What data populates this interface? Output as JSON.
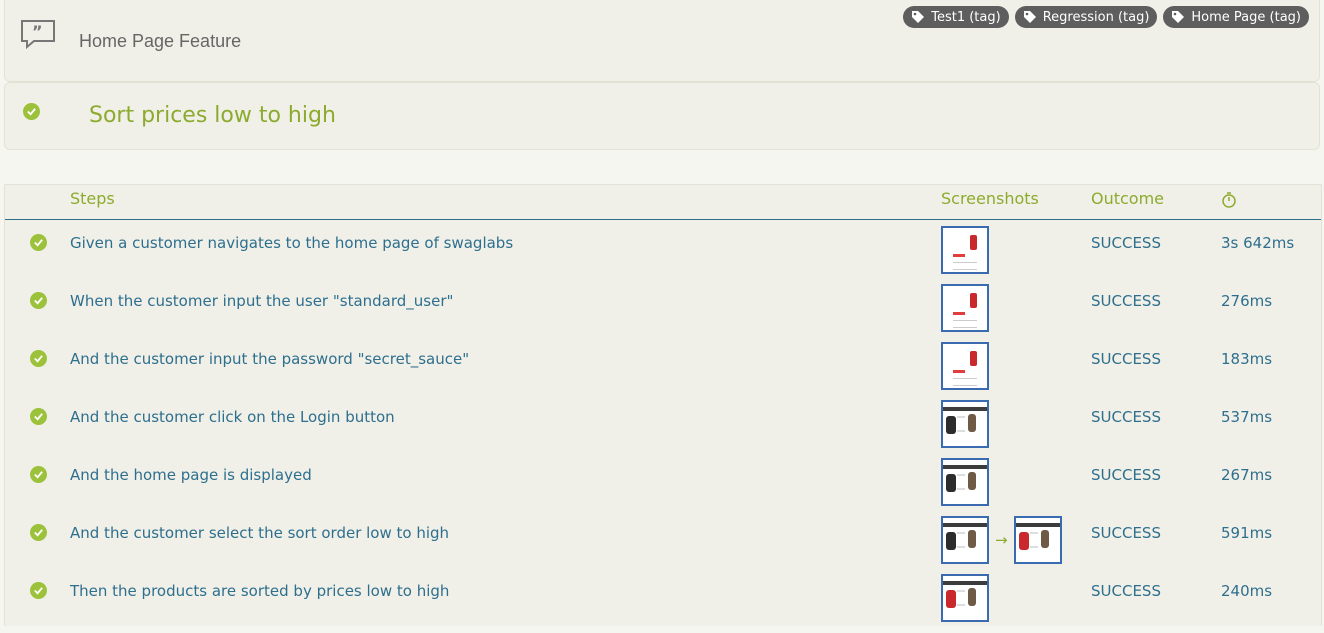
{
  "feature": {
    "title": "Home Page Feature",
    "icon": "quote-icon",
    "tags": [
      "Test1 (tag)",
      "Regression (tag)",
      "Home Page (tag)"
    ]
  },
  "scenario": {
    "title": "Sort prices low to high",
    "status_icon": "check-circle-icon"
  },
  "table": {
    "headers": {
      "steps": "Steps",
      "screenshots": "Screenshots",
      "outcome": "Outcome",
      "duration_icon": "stopwatch-icon"
    },
    "rows": [
      {
        "step": "Given a customer navigates to the home page of swaglabs",
        "screenshots": [
          "login-page"
        ],
        "outcome": "SUCCESS",
        "duration": "3s 642ms"
      },
      {
        "step": "When the customer input the user \"standard_user\"",
        "screenshots": [
          "login-page"
        ],
        "outcome": "SUCCESS",
        "duration": "276ms"
      },
      {
        "step": "And the customer input the password \"secret_sauce\"",
        "screenshots": [
          "login-page"
        ],
        "outcome": "SUCCESS",
        "duration": "183ms"
      },
      {
        "step": "And the customer click on the Login button",
        "screenshots": [
          "products-page"
        ],
        "outcome": "SUCCESS",
        "duration": "537ms"
      },
      {
        "step": "And the home page is displayed",
        "screenshots": [
          "products-page"
        ],
        "outcome": "SUCCESS",
        "duration": "267ms"
      },
      {
        "step": "And the customer select the sort order low to high",
        "screenshots": [
          "products-page",
          "products-sorted"
        ],
        "outcome": "SUCCESS",
        "duration": "591ms"
      },
      {
        "step": "Then the products are sorted by prices low to high",
        "screenshots": [
          "products-sorted"
        ],
        "outcome": "SUCCESS",
        "duration": "240ms"
      }
    ]
  },
  "colors": {
    "accent_green": "#8cab2e",
    "link_blue": "#2e6f8e",
    "success_check": "#9bc23a",
    "tag_bg": "#5e5e5e"
  }
}
